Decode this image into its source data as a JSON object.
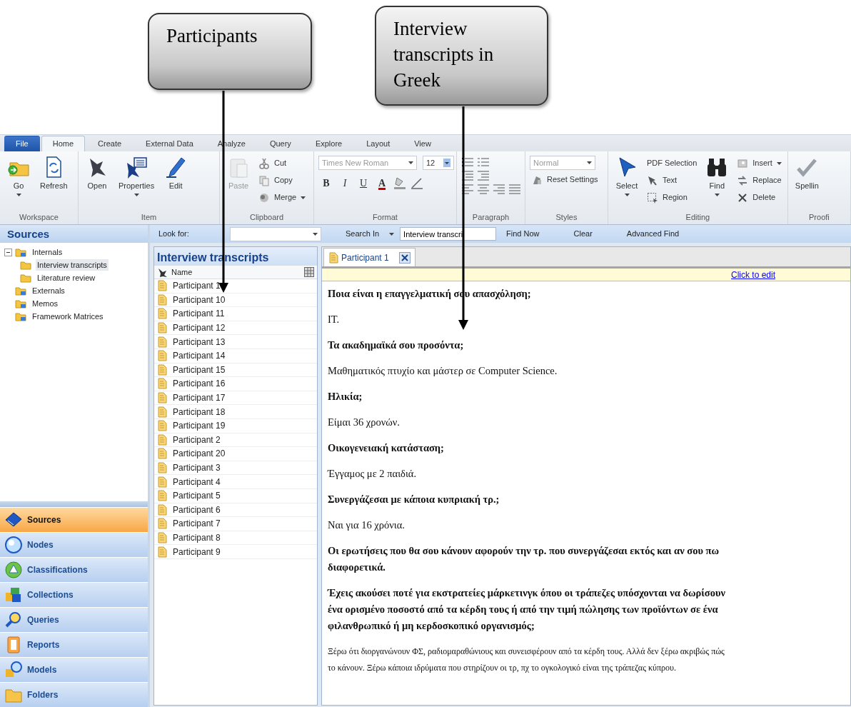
{
  "callouts": [
    {
      "text": "Participants"
    },
    {
      "text": "Interview transcripts in Greek"
    }
  ],
  "ribbon_tabs": [
    {
      "label": "File",
      "kind": "file",
      "selected": false
    },
    {
      "label": "Home",
      "kind": "tab",
      "selected": true
    },
    {
      "label": "Create",
      "kind": "tab",
      "selected": false
    },
    {
      "label": "External Data",
      "kind": "tab",
      "selected": false
    },
    {
      "label": "Analyze",
      "kind": "tab",
      "selected": false
    },
    {
      "label": "Query",
      "kind": "tab",
      "selected": false
    },
    {
      "label": "Explore",
      "kind": "tab",
      "selected": false
    },
    {
      "label": "Layout",
      "kind": "tab",
      "selected": false
    },
    {
      "label": "View",
      "kind": "tab",
      "selected": false
    }
  ],
  "ribbon_groups": [
    {
      "label": "Workspace",
      "kind": "stack",
      "items": [
        {
          "kind": "large",
          "label": "Go",
          "dropdown": true,
          "disabled": false
        },
        {
          "kind": "large",
          "label": "Refresh",
          "dropdown": false,
          "disabled": false
        }
      ]
    },
    {
      "label": "Item",
      "kind": "stack",
      "items": [
        {
          "kind": "large",
          "label": "Open",
          "dropdown": false,
          "disabled": false
        },
        {
          "kind": "large",
          "label": "Properties",
          "dropdown": true,
          "disabled": false
        },
        {
          "kind": "large",
          "label": "Edit",
          "dropdown": false,
          "disabled": false
        }
      ]
    },
    {
      "label": "Clipboard",
      "kind": "stack",
      "items": [
        {
          "kind": "large",
          "label": "Paste",
          "dropdown": false,
          "disabled": true
        },
        {
          "kind": "small",
          "label": "Cut",
          "dropdown": false,
          "disabled": false
        },
        {
          "kind": "small",
          "label": "Copy",
          "dropdown": false,
          "disabled": false
        },
        {
          "kind": "small",
          "label": "Merge",
          "dropdown": true,
          "disabled": false
        }
      ]
    },
    {
      "label": "Format",
      "kind": "format",
      "font": {
        "value": "Times New Roman",
        "disabled": true
      },
      "size": {
        "value": "12",
        "disabled": false
      },
      "styles": [
        "B",
        "I",
        "U",
        "A"
      ]
    },
    {
      "label": "Paragraph",
      "kind": "paragraph"
    },
    {
      "label": "Styles",
      "kind": "stack",
      "items": [
        {
          "kind": "combo",
          "label": "Normal",
          "dropdown": true,
          "disabled": true
        },
        {
          "kind": "small",
          "label": "Reset Settings",
          "dropdown": false,
          "disabled": false
        }
      ]
    },
    {
      "label": "Editing",
      "kind": "stack",
      "items": [
        {
          "kind": "large",
          "label": "Select",
          "dropdown": true,
          "disabled": false
        },
        {
          "kind": "small",
          "label": "PDF Selection",
          "dropdown": false,
          "disabled": false
        },
        {
          "kind": "small",
          "label": "Text",
          "dropdown": false,
          "disabled": false
        },
        {
          "kind": "small",
          "label": "Region",
          "dropdown": false,
          "disabled": false
        },
        {
          "kind": "large",
          "label": "Find",
          "dropdown": true,
          "disabled": false
        },
        {
          "kind": "small",
          "label": "Insert",
          "dropdown": true,
          "disabled": false
        },
        {
          "kind": "small",
          "label": "Replace",
          "dropdown": false,
          "disabled": false
        },
        {
          "kind": "small",
          "label": "Delete",
          "dropdown": false,
          "disabled": false
        }
      ]
    },
    {
      "label": "Proofi",
      "kind": "stack",
      "items": [
        {
          "kind": "large",
          "label": "Spellin",
          "dropdown": false,
          "disabled": false
        }
      ]
    }
  ],
  "find_bar": {
    "look_for_label": "Look for:",
    "search_in": "Search In",
    "search_in_value": "Interview transcri",
    "buttons": [
      "Find Now",
      "Clear",
      "Advanced Find"
    ]
  },
  "sources": {
    "title": "Sources",
    "tree": [
      {
        "label": "Internals",
        "expanded": true,
        "selected": false,
        "children": [
          {
            "label": "Interview transcripts",
            "selected": true
          },
          {
            "label": "Literature review",
            "selected": false
          }
        ]
      },
      {
        "label": "Externals",
        "selected": false
      },
      {
        "label": "Memos",
        "selected": false
      },
      {
        "label": "Framework Matrices",
        "selected": false
      }
    ]
  },
  "navigation": [
    {
      "label": "Sources",
      "selected": true
    },
    {
      "label": "Nodes",
      "selected": false
    },
    {
      "label": "Classifications",
      "selected": false
    },
    {
      "label": "Collections",
      "selected": false
    },
    {
      "label": "Queries",
      "selected": false
    },
    {
      "label": "Reports",
      "selected": false
    },
    {
      "label": "Models",
      "selected": false
    },
    {
      "label": "Folders",
      "selected": false
    }
  ],
  "list": {
    "title": "Interview transcripts",
    "columns": [
      "Name"
    ],
    "rows": [
      "Participant 1",
      "Participant 10",
      "Participant 11",
      "Participant 12",
      "Participant 13",
      "Participant 14",
      "Participant 15",
      "Participant 16",
      "Participant 17",
      "Participant 18",
      "Participant 19",
      "Participant 2",
      "Participant 20",
      "Participant 3",
      "Participant 4",
      "Participant 5",
      "Participant 6",
      "Participant 7",
      "Participant 8",
      "Participant 9"
    ]
  },
  "document": {
    "tab": "Participant 1",
    "edit_link": "Click to edit",
    "paragraphs": [
      {
        "kind": "question",
        "text": "Ποια είναι η επαγγελματική σου απασχόληση;"
      },
      {
        "kind": "answer",
        "text": "IT."
      },
      {
        "kind": "question",
        "text": "Τα ακαδημαϊκά σου προσόντα;"
      },
      {
        "kind": "answer",
        "text": "Μαθηματικός πτυχίο και μάστερ σε Computer Science."
      },
      {
        "kind": "question",
        "text": "Ηλικία;"
      },
      {
        "kind": "answer",
        "text": "Είμαι 36 χρονών."
      },
      {
        "kind": "question",
        "text": "Οικογενειακή κατάσταση;"
      },
      {
        "kind": "answer",
        "text": "Έγγαμος με 2 παιδιά."
      },
      {
        "kind": "question",
        "text": "Συνεργάζεσαι με κάποια κυπριακή τρ.;"
      },
      {
        "kind": "answer",
        "text": "Ναι για 16 χρόνια."
      },
      {
        "kind": "question",
        "text": "Οι ερωτήσεις που θα σου κάνουν αφορούν την τρ. που συνεργάζεσαι εκτός και αν σου πω διαφορετικά."
      },
      {
        "kind": "question",
        "text": "Έχεις ακούσει ποτέ για εκστρατείες μάρκετινγκ όπου οι τράπεζες υπόσχονται να δωρίσουν ένα ορισμένο ποσοστό από τα κέρδη τους ή από την τιμή πώλησης των προϊόντων σε ένα φιλανθρωπικό ή μη κερδοσκοπικό οργανισμός;"
      },
      {
        "kind": "note",
        "text": "Ξέρω ότι διοργανώνουν ΦΣ, ραδιομαραθώνιους και συνεισφέρουν από τα κέρδη τους. Αλλά δεν ξέρω ακριβώς πώς το κάνουν. Ξέρω κάποια ιδρύματα που στηρίζουν οι τρ, πχ το ογκολογικό είναι της τράπεζας κύπρου."
      }
    ]
  }
}
